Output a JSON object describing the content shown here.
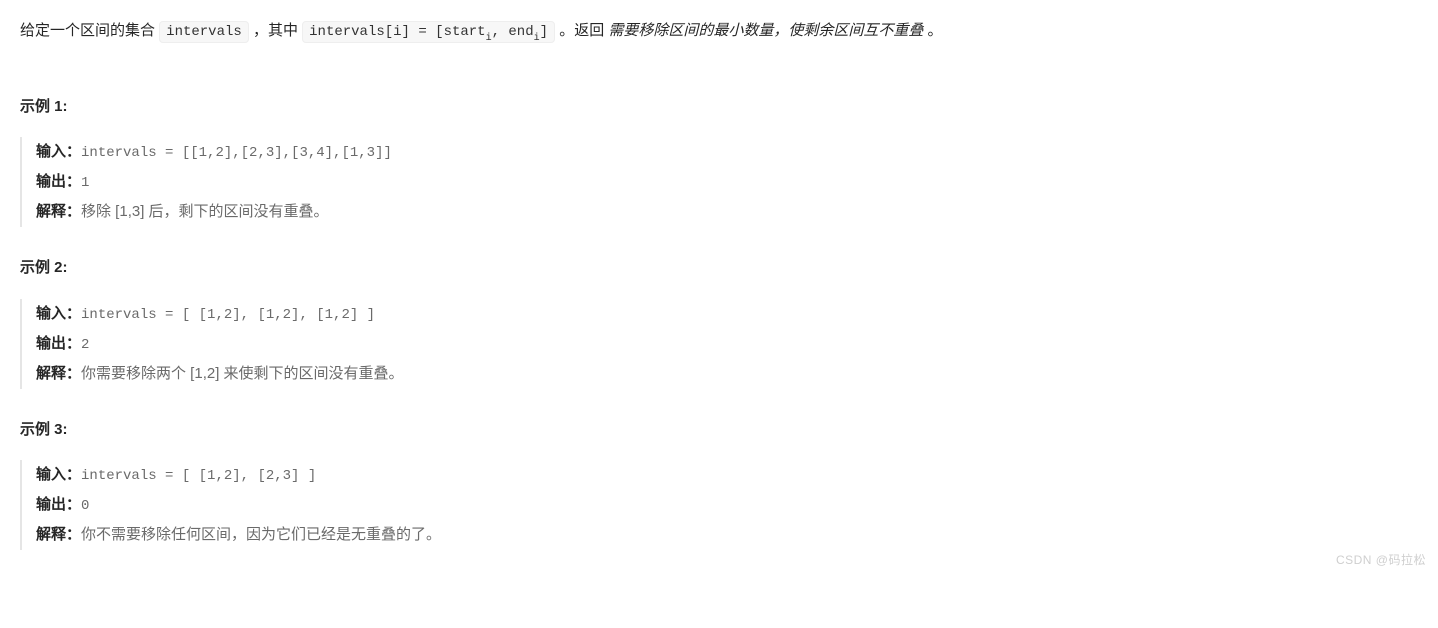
{
  "intro": {
    "part1": "给定一个区间的集合 ",
    "code1": "intervals",
    "part2": " ，其中 ",
    "code2_prefix": "intervals[i] = [start",
    "code2_sub1": "i",
    "code2_mid": ", end",
    "code2_sub2": "i",
    "code2_suffix": "]",
    "part3": " 。返回 ",
    "italic": "需要移除区间的最小数量，使剩余区间互不重叠 ",
    "part4": "。"
  },
  "examples": [
    {
      "title": "示例 1:",
      "input_label": "输入：",
      "input_value": "intervals = [[1,2],[2,3],[3,4],[1,3]]",
      "output_label": "输出：",
      "output_value": "1",
      "explain_label": "解释：",
      "explain_value": "移除 [1,3] 后，剩下的区间没有重叠。"
    },
    {
      "title": "示例 2:",
      "input_label": "输入：",
      "input_value": "intervals = [ [1,2], [1,2], [1,2] ]",
      "output_label": "输出：",
      "output_value": "2",
      "explain_label": "解释：",
      "explain_value": "你需要移除两个 [1,2] 来使剩下的区间没有重叠。"
    },
    {
      "title": "示例 3:",
      "input_label": "输入：",
      "input_value": "intervals = [ [1,2], [2,3] ]",
      "output_label": "输出：",
      "output_value": "0",
      "explain_label": "解释：",
      "explain_value": "你不需要移除任何区间，因为它们已经是无重叠的了。"
    }
  ],
  "watermark": "CSDN @码拉松"
}
